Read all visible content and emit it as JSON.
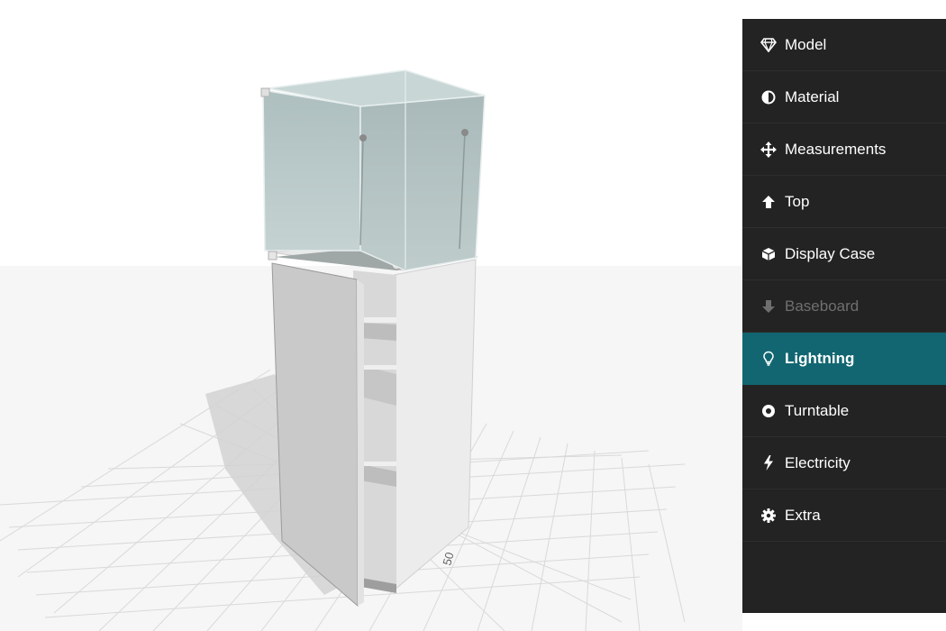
{
  "viewport": {
    "grid_label": "50"
  },
  "sidebar": {
    "items": [
      {
        "label": "Model",
        "icon": "diamond-icon",
        "state": "normal"
      },
      {
        "label": "Material",
        "icon": "half-circle-icon",
        "state": "normal"
      },
      {
        "label": "Measurements",
        "icon": "move-arrows-icon",
        "state": "normal"
      },
      {
        "label": "Top",
        "icon": "arrow-up-icon",
        "state": "normal"
      },
      {
        "label": "Display Case",
        "icon": "cube-icon",
        "state": "normal"
      },
      {
        "label": "Baseboard",
        "icon": "arrow-down-icon",
        "state": "disabled"
      },
      {
        "label": "Lightning",
        "icon": "lightbulb-icon",
        "state": "active"
      },
      {
        "label": "Turntable",
        "icon": "circle-dot-icon",
        "state": "normal"
      },
      {
        "label": "Electricity",
        "icon": "bolt-icon",
        "state": "normal"
      },
      {
        "label": "Extra",
        "icon": "gear-icon",
        "state": "normal"
      }
    ]
  },
  "colors": {
    "sidebar_bg": "#232323",
    "active_bg": "#116671",
    "disabled_text": "#6f6f6f",
    "floor": "#f6f6f6",
    "glass": "#b9c8c8"
  }
}
